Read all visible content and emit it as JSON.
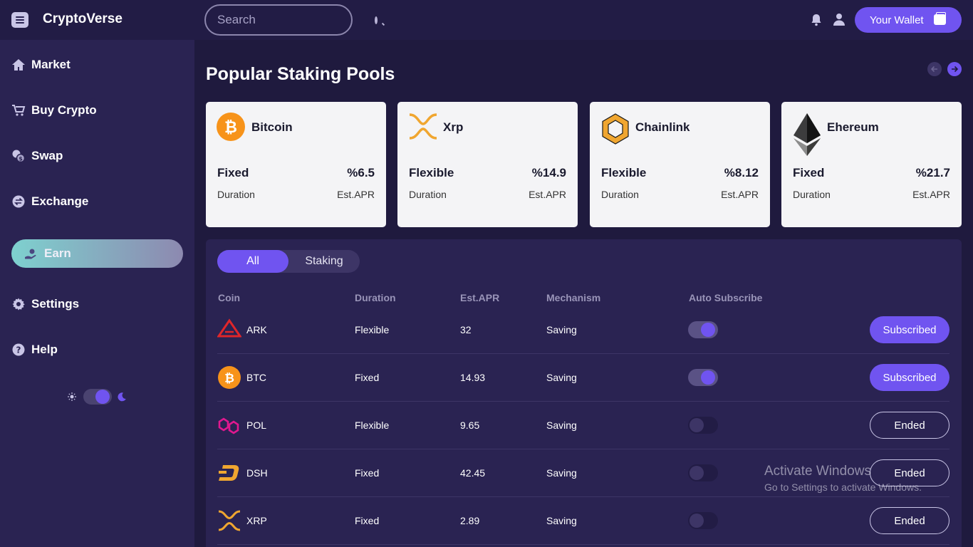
{
  "app": {
    "title": "CryptoVerse"
  },
  "header": {
    "search_placeholder": "Search",
    "wallet_label": "Your Wallet"
  },
  "sidebar": {
    "items": [
      {
        "label": "Market",
        "icon": "home-icon"
      },
      {
        "label": "Buy Crypto",
        "icon": "cart-icon"
      },
      {
        "label": "Swap",
        "icon": "swap-icon"
      },
      {
        "label": "Exchange",
        "icon": "exchange-icon"
      },
      {
        "label": "Earn",
        "icon": "earn-icon",
        "active": true
      },
      {
        "label": "Settings",
        "icon": "gear-icon"
      },
      {
        "label": "Help",
        "icon": "help-icon"
      }
    ],
    "theme": "dark"
  },
  "main": {
    "title": "Popular Staking Pools",
    "pools": [
      {
        "name": "Bitcoin",
        "type": "Fixed",
        "apr": "%6.5",
        "duration_label": "Duration",
        "apr_label": "Est.APR",
        "icon": "bitcoin-icon"
      },
      {
        "name": "Xrp",
        "type": "Flexible",
        "apr": "%14.9",
        "duration_label": "Duration",
        "apr_label": "Est.APR",
        "icon": "xrp-icon"
      },
      {
        "name": "Chainlink",
        "type": "Flexible",
        "apr": "%8.12",
        "duration_label": "Duration",
        "apr_label": "Est.APR",
        "icon": "chainlink-icon"
      },
      {
        "name": "Ehereum",
        "type": "Fixed",
        "apr": "%21.7",
        "duration_label": "Duration",
        "apr_label": "Est.APR",
        "icon": "ethereum-icon"
      }
    ],
    "tabs": [
      {
        "label": "All",
        "active": true
      },
      {
        "label": "Staking",
        "active": false
      }
    ],
    "columns": [
      "Coin",
      "Duration",
      "Est.APR",
      "Mechanism",
      "Auto Subscribe"
    ],
    "rows": [
      {
        "coin": "ARK",
        "duration": "Flexible",
        "apr": "32",
        "mechanism": "Saving",
        "auto": true,
        "status": "Subscribed",
        "icon": "ark-icon"
      },
      {
        "coin": "BTC",
        "duration": "Fixed",
        "apr": "14.93",
        "mechanism": "Saving",
        "auto": true,
        "status": "Subscribed",
        "icon": "bitcoin-icon"
      },
      {
        "coin": "POL",
        "duration": "Flexible",
        "apr": "9.65",
        "mechanism": "Saving",
        "auto": false,
        "status": "Ended",
        "icon": "polygon-icon"
      },
      {
        "coin": "DSH",
        "duration": "Fixed",
        "apr": "42.45",
        "mechanism": "Saving",
        "auto": false,
        "status": "Ended",
        "icon": "dash-icon"
      },
      {
        "coin": "XRP",
        "duration": "Fixed",
        "apr": "2.89",
        "mechanism": "Saving",
        "auto": false,
        "status": "Ended",
        "icon": "xrp-icon"
      }
    ]
  },
  "watermark": {
    "title": "Activate Windows",
    "subtitle": "Go to Settings to activate Windows."
  },
  "colors": {
    "accent": "#7054f0",
    "background": "#1f1a3e",
    "sidebar": "#2a2352"
  }
}
